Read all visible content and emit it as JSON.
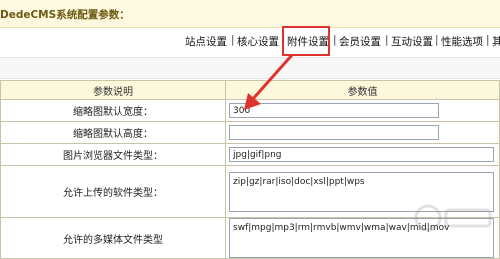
{
  "header": {
    "title": "DedeCMS系统配置参数："
  },
  "tabs": [
    {
      "label": "站点设置"
    },
    {
      "label": "核心设置"
    },
    {
      "label": "附件设置"
    },
    {
      "label": "会员设置"
    },
    {
      "label": "互动设置"
    },
    {
      "label": "性能选项"
    },
    {
      "label": "其"
    }
  ],
  "table": {
    "headers": [
      "参数说明",
      "参数值"
    ],
    "rows": [
      {
        "label": "缩略图默认宽度：",
        "value": "300"
      },
      {
        "label": "缩略图默认高度：",
        "value": ""
      },
      {
        "label": "图片浏览器文件类型：",
        "value": "jpg|gif|png"
      },
      {
        "label": "允许上传的软件类型：",
        "value": "zip|gz|rar|iso|doc|xsl|ppt|wps"
      },
      {
        "label": "允许的多媒体文件类型",
        "value": "swf|mpg|mp3|rm|rmvb|wmv|wma|wav|mid|mov"
      }
    ]
  },
  "colors": {
    "highlight": "#e0322c",
    "arrow": "#e0322c",
    "header_bg": "#fdf8e0"
  },
  "icons": {
    "arrow": "red-pointer-arrow",
    "watermark": "baidu-jingyan-watermark"
  }
}
